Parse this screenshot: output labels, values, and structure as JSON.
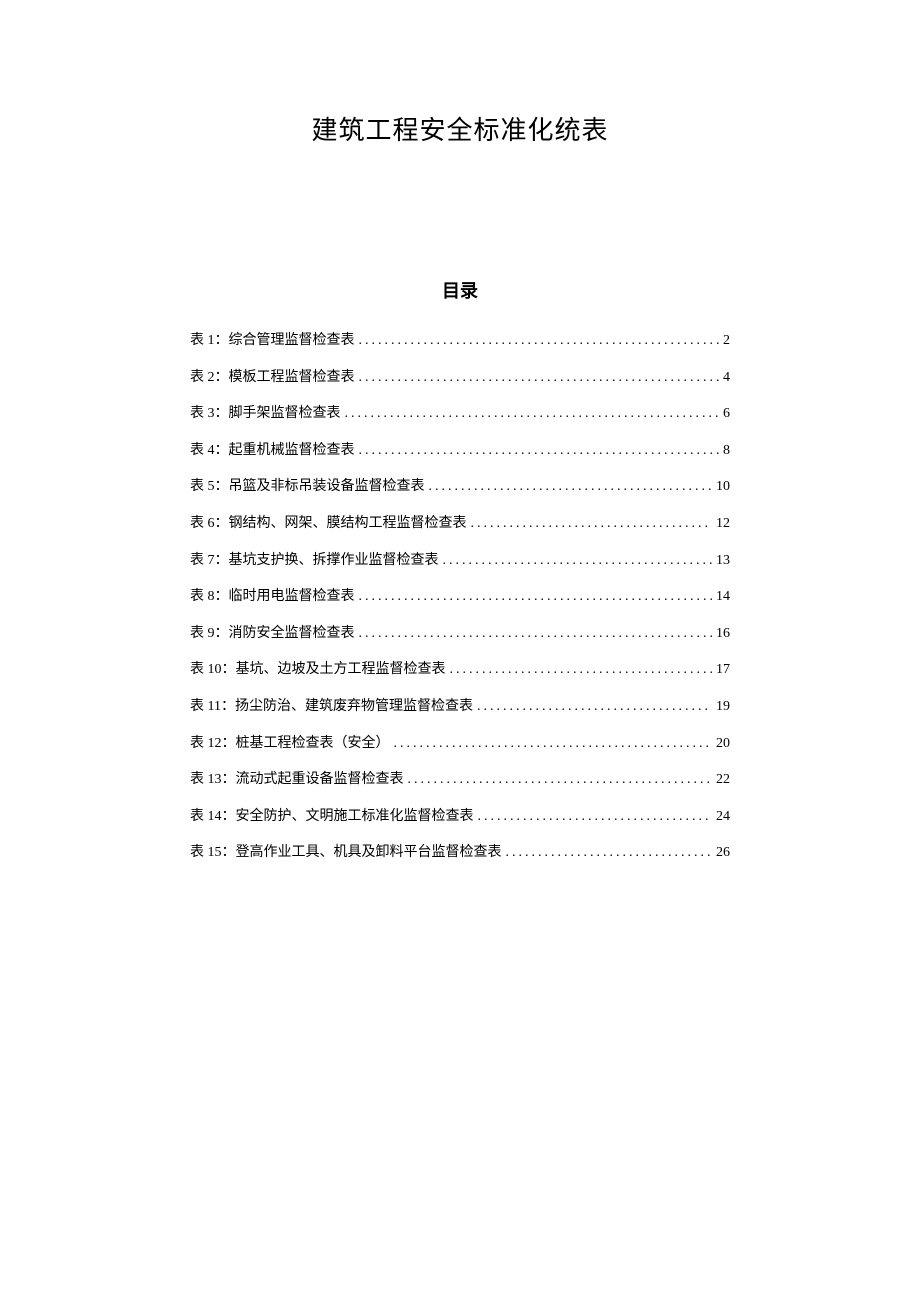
{
  "title": "建筑工程安全标准化统表",
  "toc_heading": "目录",
  "toc": [
    {
      "label": "表 1：综合管理监督检查表",
      "page": "2"
    },
    {
      "label": "表 2：模板工程监督检查表",
      "page": "4"
    },
    {
      "label": "表 3：脚手架监督检查表",
      "page": "6"
    },
    {
      "label": "表 4：起重机械监督检查表",
      "page": "8"
    },
    {
      "label": "表 5：吊篮及非标吊装设备监督检查表",
      "page": "10"
    },
    {
      "label": "表 6：钢结构、网架、膜结构工程监督检查表",
      "page": "12"
    },
    {
      "label": "表 7：基坑支护换、拆撑作业监督检查表",
      "page": "13"
    },
    {
      "label": "表 8：临时用电监督检查表",
      "page": "14"
    },
    {
      "label": "表 9：消防安全监督检查表",
      "page": "16"
    },
    {
      "label": "表 10：基坑、边坡及土方工程监督检查表",
      "page": "17"
    },
    {
      "label": "表 11：扬尘防治、建筑废弃物管理监督检查表",
      "page": "19"
    },
    {
      "label": "表 12：桩基工程检查表（安全）",
      "page": "20"
    },
    {
      "label": "表 13：流动式起重设备监督检查表",
      "page": "22"
    },
    {
      "label": "表 14：安全防护、文明施工标准化监督检查表",
      "page": "24"
    },
    {
      "label": "表 15：登高作业工具、机具及卸料平台监督检查表",
      "page": "26"
    }
  ]
}
